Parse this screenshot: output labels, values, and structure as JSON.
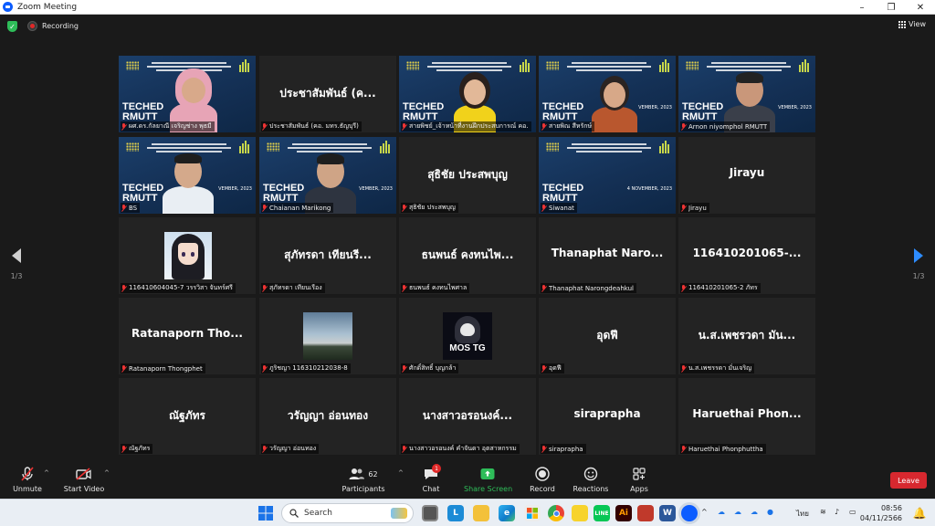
{
  "window": {
    "title": "Zoom Meeting"
  },
  "topbar": {
    "recording_label": "Recording",
    "view_label": "View"
  },
  "paging": {
    "left_label": "1/3",
    "right_label": "1/3"
  },
  "slide": {
    "brand_line1": "TECHED",
    "brand_line2": "RMUTT",
    "date_text": "4 NOVEMBER, 2023",
    "date_partial": "VEMBER, 2023"
  },
  "tiles": [
    {
      "big": "",
      "caption": "ผศ.ดร.กัลยาณี  เจริญช่าง พุธมี"
    },
    {
      "big": "ประชาสัมพันธ์ (ค...",
      "caption": "ประชาสัมพันธ์ (คอ. มทร.ธัญบุรี)"
    },
    {
      "big": "",
      "caption": "สายพิชย์_เจ้าหน้าที่งานฝึกประสบการณ์ คอ."
    },
    {
      "big": "",
      "caption": "สายพิณ สีหรักษ์"
    },
    {
      "big": "",
      "caption": "Arnon niyomphol RMUTT"
    },
    {
      "big": "",
      "caption": "BS"
    },
    {
      "big": "",
      "caption": "Chaianan Marikong"
    },
    {
      "big": "สุธิชัย ประสพบุญ",
      "caption": "สุธิชัย ประสพบุญ"
    },
    {
      "big": "",
      "caption": "Siwanat"
    },
    {
      "big": "Jirayu",
      "caption": "Jirayu"
    },
    {
      "big": "",
      "caption": "116410604045-7 วรรวิสา จันทร์ศรี"
    },
    {
      "big": "สุภัทรดา เทียนรี...",
      "caption": "สุภัทรดา เทียนเรือง"
    },
    {
      "big": "ธนพนธ์ คงทนไพ...",
      "caption": "ธนพนธ์ คงทนไพศาล"
    },
    {
      "big": "Thanaphat  Naro...",
      "caption": "Thanaphat Narongdeahkul"
    },
    {
      "big": "116410201065-...",
      "caption": "116410201065-2 ภัทร"
    },
    {
      "big": "Ratanaporn  Tho...",
      "caption": "Ratanaporn Thongphet"
    },
    {
      "big": "",
      "caption": "ภูริชญา 116310212038-8"
    },
    {
      "big": "",
      "caption": "ศักดิ์สิทธิ์ บุญกล้า",
      "avatar_text": "MOS TG"
    },
    {
      "big": "อุดฟี",
      "caption": "อุดฟี"
    },
    {
      "big": "น.ส.เพชรวดา มัน...",
      "caption": "น.ส.เพชรรดา มั่นเจริญ"
    },
    {
      "big": "ณัฐภัทร",
      "caption": "ณัฐภัทร"
    },
    {
      "big": "วรัญญา อ่อนทอง",
      "caption": "วรัญญา อ่อนทอง"
    },
    {
      "big": "นางสาวอรอนงค์...",
      "caption": "นางสาวอรอนงค์ คำจันดา อุตสาหกรรม"
    },
    {
      "big": "siraprapha",
      "caption": "siraprapha"
    },
    {
      "big": "Haruethai  Phon...",
      "caption": "Haruethai Phonphuttha"
    }
  ],
  "toolbar": {
    "unmute": "Unmute",
    "start_video": "Start Video",
    "participants": "Participants",
    "participants_count": "62",
    "chat": "Chat",
    "chat_badge": "1",
    "share_screen": "Share Screen",
    "record": "Record",
    "reactions": "Reactions",
    "apps": "Apps",
    "leave": "Leave",
    "share_color": "#2ebd59",
    "leave_color": "#d7282f"
  },
  "taskbar": {
    "search_label": "Search",
    "language": "ไทย",
    "time": "08:56",
    "date": "04/11/2566"
  }
}
